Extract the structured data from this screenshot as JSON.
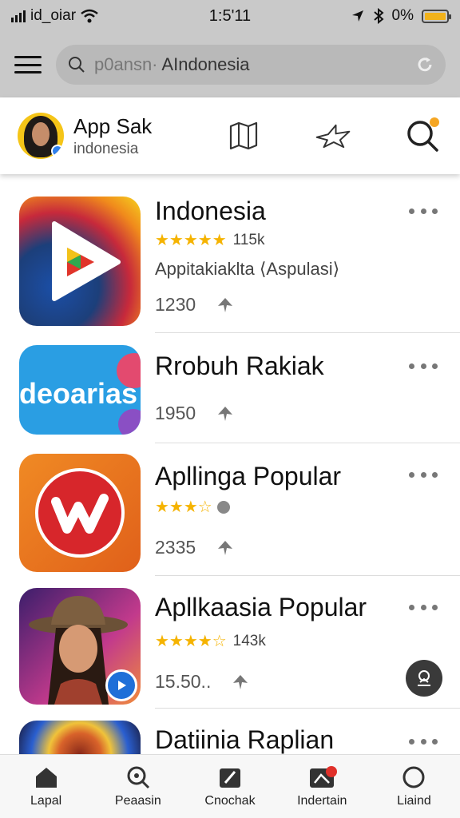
{
  "status_bar": {
    "carrier": "id_oiar",
    "time": "1:5'11",
    "battery_pct": "0%",
    "battery_color": "#f1b21b"
  },
  "search": {
    "query_placeholder": "p0ansn·",
    "query_value": "AIndonesia",
    "search_icon": "search-icon",
    "refresh_icon": "refresh-icon"
  },
  "profile": {
    "title": "App Sak",
    "subtitle": "indonesia",
    "icons": [
      "map-icon",
      "star-outline-icon",
      "search-icon"
    ],
    "notification_color": "#f5a623"
  },
  "apps": [
    {
      "name": "Indonesia",
      "rating": "★★★★★",
      "rating_count": "115k",
      "description": "Appitakiaklta ⟨Aspulasi⟩",
      "value": "1230"
    },
    {
      "name": "Rrobuh Rakiak",
      "icon_text": "deoarias",
      "value": "1950"
    },
    {
      "name": "Apllinga Popular",
      "rating": "★★★☆",
      "value": "2335"
    },
    {
      "name": "Apllkaasia Popular",
      "rating": "★★★★☆",
      "rating_count": "143k",
      "value": "15.50.."
    },
    {
      "name": "Datiinia Raplian"
    }
  ],
  "bottom_nav": [
    {
      "label": "Lapal",
      "icon": "home-icon"
    },
    {
      "label": "Peaasin",
      "icon": "search-icon"
    },
    {
      "label": "Cnochak",
      "icon": "edit-icon"
    },
    {
      "label": "Indertain",
      "icon": "image-icon"
    },
    {
      "label": "Liaind",
      "icon": "circle-icon"
    }
  ]
}
